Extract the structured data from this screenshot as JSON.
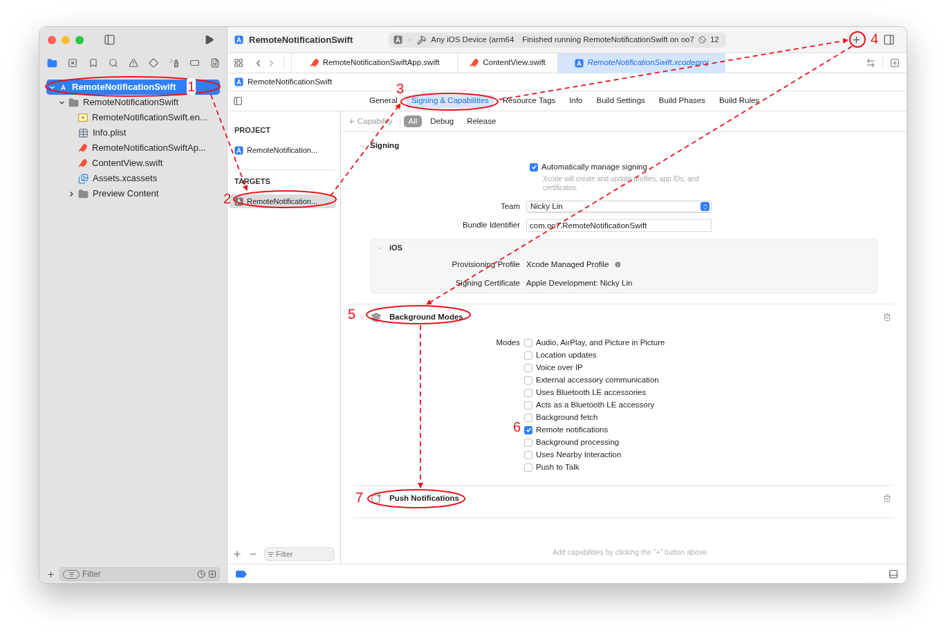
{
  "window": {
    "title": "RemoteNotificationSwift"
  },
  "toolbar": {
    "scheme": "Any iOS Device (arm64",
    "status": "Finished running RemoteNotificationSwift on oo7",
    "issue_count": "12"
  },
  "navigator": {
    "tree": [
      {
        "label": "RemoteNotificationSwift",
        "kind": "project",
        "selected": true,
        "expanded": true,
        "children": [
          {
            "label": "RemoteNotificationSwift",
            "kind": "folder",
            "selected": false,
            "expanded": true,
            "children": [
              {
                "label": "RemoteNotificationSwift.en...",
                "kind": "entitlements",
                "selected": false
              },
              {
                "label": "Info.plist",
                "kind": "plist",
                "selected": false
              },
              {
                "label": "RemoteNotificationSwiftAp...",
                "kind": "swift",
                "selected": false
              },
              {
                "label": "ContentView.swift",
                "kind": "swift",
                "selected": false
              },
              {
                "label": "Assets.xcassets",
                "kind": "assets",
                "selected": false
              },
              {
                "label": "Preview Content",
                "kind": "folder",
                "selected": false,
                "expanded": false
              }
            ]
          }
        ]
      }
    ],
    "filter_placeholder": "Filter"
  },
  "editor_tabs": [
    {
      "label": "RemoteNotificationSwiftApp.swift",
      "kind": "swift",
      "selected": false
    },
    {
      "label": "ContentView.swift",
      "kind": "swift",
      "selected": false
    },
    {
      "label": "RemoteNotificationSwift.xcodeproj",
      "kind": "project",
      "selected": true
    }
  ],
  "jump_bar": "RemoteNotificationSwift",
  "settings_tabs": [
    {
      "label": "General",
      "selected": false
    },
    {
      "label": "Signing & Capabilities",
      "selected": true
    },
    {
      "label": "Resource Tags",
      "selected": false
    },
    {
      "label": "Info",
      "selected": false
    },
    {
      "label": "Build Settings",
      "selected": false
    },
    {
      "label": "Build Phases",
      "selected": false
    },
    {
      "label": "Build Rules",
      "selected": false
    }
  ],
  "targets_list": {
    "sections": [
      {
        "heading": "PROJECT",
        "items": [
          {
            "label": "RemoteNotification...",
            "kind": "project",
            "selected": false
          }
        ]
      },
      {
        "heading": "TARGETS",
        "items": [
          {
            "label": "RemoteNotification...",
            "kind": "target",
            "selected": true
          }
        ]
      }
    ],
    "filter_placeholder": "Filter"
  },
  "capability_bar": {
    "add_label": "Capability",
    "filters": [
      {
        "label": "All",
        "selected": true
      },
      {
        "label": "Debug",
        "selected": false
      },
      {
        "label": "Release",
        "selected": false
      }
    ]
  },
  "signing": {
    "title": "Signing",
    "auto_manage": {
      "label": "Automatically manage signing",
      "checked": true,
      "hint": "Xcode will create and update profiles, app IDs, and certificates."
    },
    "team": {
      "label": "Team",
      "value": "Nicky Lin"
    },
    "bundle_identifier": {
      "label": "Bundle Identifier",
      "value": "com.oo7.RemoteNotificationSwift"
    },
    "platform": {
      "title": "iOS",
      "rows": [
        {
          "label": "Provisioning Profile",
          "value": "Xcode Managed Profile",
          "has_info": true
        },
        {
          "label": "Signing Certificate",
          "value": "Apple Development: Nicky Lin",
          "has_info": false
        }
      ]
    }
  },
  "capabilities": [
    {
      "title": "Background Modes",
      "kind": "background_modes",
      "modes_label": "Modes",
      "modes": [
        {
          "label": "Audio, AirPlay, and Picture in Picture",
          "checked": false
        },
        {
          "label": "Location updates",
          "checked": false
        },
        {
          "label": "Voice over IP",
          "checked": false
        },
        {
          "label": "External accessory communication",
          "checked": false
        },
        {
          "label": "Uses Bluetooth LE accessories",
          "checked": false
        },
        {
          "label": "Acts as a Bluetooth LE accessory",
          "checked": false
        },
        {
          "label": "Background fetch",
          "checked": false
        },
        {
          "label": "Remote notifications",
          "checked": true
        },
        {
          "label": "Background processing",
          "checked": false
        },
        {
          "label": "Uses Nearby Interaction",
          "checked": false
        },
        {
          "label": "Push to Talk",
          "checked": false
        }
      ]
    },
    {
      "title": "Push Notifications",
      "kind": "push"
    }
  ],
  "empty_hint": "Add capabilities by clicking the \"+\" button above.",
  "annotations": [
    {
      "label": "1"
    },
    {
      "label": "2"
    },
    {
      "label": "3"
    },
    {
      "label": "4"
    },
    {
      "label": "5"
    },
    {
      "label": "6"
    },
    {
      "label": "7"
    }
  ]
}
